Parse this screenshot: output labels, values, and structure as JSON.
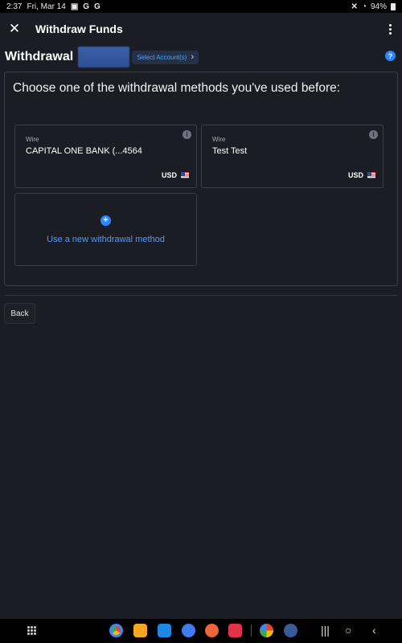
{
  "status_bar": {
    "time": "2:37",
    "date": "Fri, Mar 14",
    "battery": "94%"
  },
  "app_bar": {
    "title": "Withdraw Funds"
  },
  "header": {
    "title": "Withdrawal",
    "select_account_label": "Select Account(s)"
  },
  "methods": {
    "heading": "Choose one of the withdrawal methods you've used before:",
    "cards": [
      {
        "type": "Wire",
        "name": "CAPITAL ONE BANK (...4564",
        "currency": "USD"
      },
      {
        "type": "Wire",
        "name": "Test Test",
        "currency": "USD"
      }
    ],
    "new_method_label": "Use a new withdrawal method"
  },
  "actions": {
    "back_label": "Back"
  },
  "colors": {
    "background": "#1b1d25",
    "accent": "#2e86ff",
    "link": "#4d9cff",
    "border": "#3a3d47"
  }
}
